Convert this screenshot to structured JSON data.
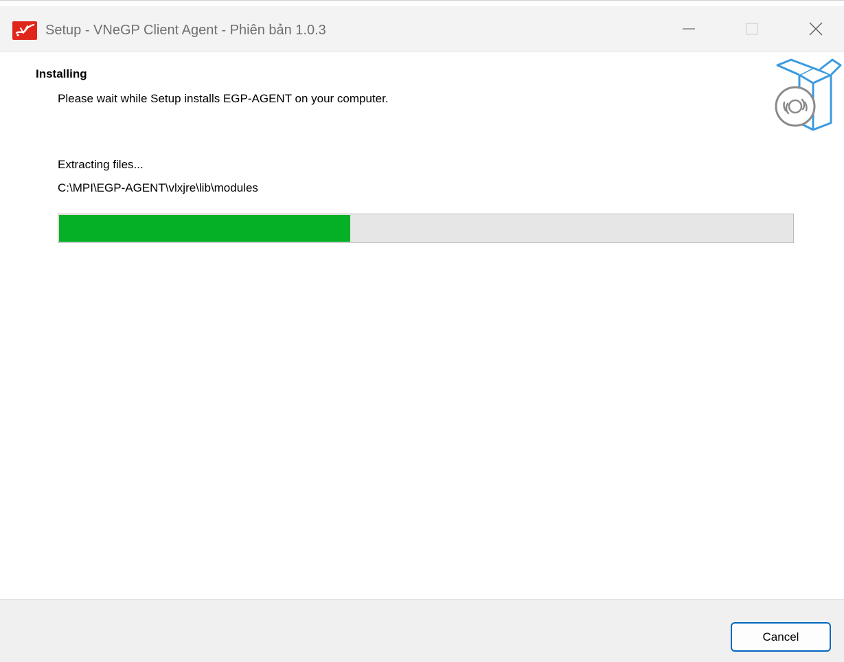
{
  "window": {
    "title": "Setup - VNeGP Client Agent - Phiên bản 1.0.3",
    "icon": "vnegp-logo-icon",
    "controls": [
      "minimize-icon",
      "maximize-icon",
      "close-icon"
    ]
  },
  "header": {
    "title": "Installing",
    "subtitle": "Please wait while Setup installs EGP-AGENT on your computer.",
    "art_icon": "software-box-disc-icon"
  },
  "progress": {
    "status": "Extracting files...",
    "path": "C:\\MPI\\EGP-AGENT\\vlxjre\\lib\\modules",
    "fraction": 0.397
  },
  "footer": {
    "cancel_label": "Cancel"
  },
  "colors": {
    "progress_fill": "#06b025",
    "progress_track": "#e6e6e6",
    "accent_border": "#0067c0",
    "logo_red": "#e0251b"
  }
}
